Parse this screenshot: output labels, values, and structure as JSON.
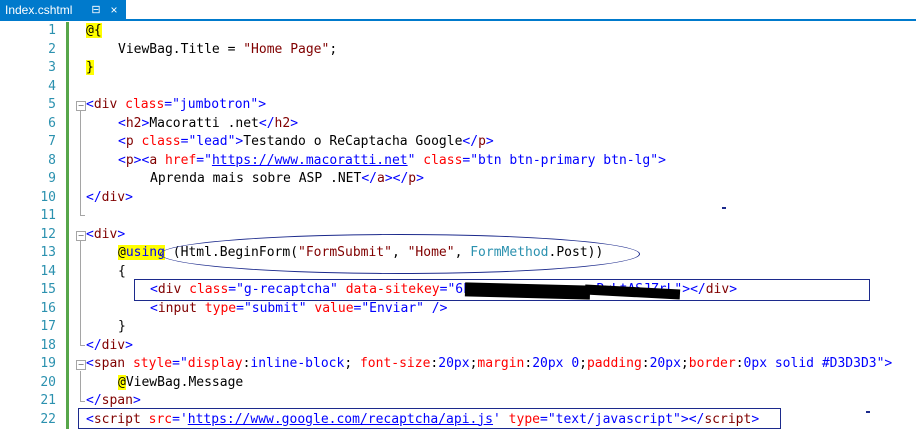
{
  "tab": {
    "title": "Index.cshtml",
    "pin_glyph": "⊟",
    "close_glyph": "×"
  },
  "lines": [
    {
      "n": "1"
    },
    {
      "n": "2"
    },
    {
      "n": "3"
    },
    {
      "n": "4"
    },
    {
      "n": "5"
    },
    {
      "n": "6"
    },
    {
      "n": "7"
    },
    {
      "n": "8"
    },
    {
      "n": "9"
    },
    {
      "n": "10"
    },
    {
      "n": "11"
    },
    {
      "n": "12"
    },
    {
      "n": "13"
    },
    {
      "n": "14"
    },
    {
      "n": "15"
    },
    {
      "n": "16"
    },
    {
      "n": "17"
    },
    {
      "n": "18"
    },
    {
      "n": "19"
    },
    {
      "n": "20"
    },
    {
      "n": "21"
    },
    {
      "n": "22"
    }
  ],
  "code": {
    "l1": {
      "at": "@{"
    },
    "l2": {
      "a": "ViewBag.Title = ",
      "b": "\"Home Page\"",
      "c": ";"
    },
    "l3": {
      "a": "}"
    },
    "l5": {
      "a": "<",
      "b": "div",
      "c": " ",
      "d": "class",
      "e": "=",
      "f": "\"jumbotron\"",
      "g": ">"
    },
    "l6": {
      "a": "<",
      "b": "h2",
      "c": ">",
      "d": "Macoratti .net",
      "e": "</",
      "f": "h2",
      "g": ">"
    },
    "l7": {
      "a": "<",
      "b": "p",
      "c": " ",
      "d": "class",
      "e": "=",
      "f": "\"lead\"",
      "g": ">",
      "h": "Testando o ReCaptacha Google",
      "i": "</",
      "j": "p",
      "k": ">"
    },
    "l8": {
      "a": "<",
      "b": "p",
      "c": "><",
      "d": "a",
      "e": " ",
      "f": "href",
      "g": "=",
      "h": "\"",
      "i": "https://www.macoratti.net",
      "j": "\"",
      "k": " ",
      "l": "class",
      "m": "=",
      "n": "\"btn btn-primary btn-lg\"",
      "o": ">"
    },
    "l9": {
      "a": "Aprenda mais sobre ASP .NET",
      "b": "</",
      "c": "a",
      "d": "></",
      "e": "p",
      "f": ">"
    },
    "l10": {
      "a": "</",
      "b": "div",
      "c": ">"
    },
    "l12": {
      "a": "<",
      "b": "div",
      "c": ">"
    },
    "l13": {
      "at": "@",
      "using": "using",
      "a": " (Html.BeginForm(",
      "b": "\"FormSubmit\"",
      "c": ", ",
      "d": "\"Home\"",
      "e": ", ",
      "f": "FormMethod",
      "g": ".Post))"
    },
    "l14": {
      "a": "{"
    },
    "l15": {
      "a": "<",
      "b": "div",
      "c": " ",
      "d": "class",
      "e": "=",
      "f": "\"g-recaptcha\"",
      "g": " ",
      "h": "data-sitekey",
      "i": "=",
      "j": "\"6Le...............PvLtASJZrL\"",
      "k": "></",
      "l": "div",
      "m": ">"
    },
    "l16": {
      "a": "<",
      "b": "input",
      "c": " ",
      "d": "type",
      "e": "=",
      "f": "\"submit\"",
      "g": " ",
      "h": "value",
      "i": "=",
      "j": "\"Enviar\"",
      "k": " />"
    },
    "l17": {
      "a": "}"
    },
    "l18": {
      "a": "</",
      "b": "div",
      "c": ">"
    },
    "l19": {
      "a": "<",
      "b": "span",
      "c": " ",
      "d": "style",
      "e": "=",
      "f": "\"",
      "g": "display",
      "h": ":",
      "i": "inline-block",
      "j": "; ",
      "k": "font-size",
      "l": ":",
      "m": "20px",
      "n": ";",
      "o": "margin",
      "p": ":",
      "q": "20px 0",
      "r": ";",
      "s": "padding",
      "t": ":",
      "u": "20px",
      "v": ";",
      "w": "border",
      "x": ":",
      "y": "0px solid #D3D3D3",
      "z": "\">"
    },
    "l20": {
      "at": "@",
      "a": "ViewBag.Message"
    },
    "l21": {
      "a": "</",
      "b": "span",
      "c": ">"
    },
    "l22": {
      "a": "<",
      "b": "script",
      "c": " ",
      "d": "src",
      "e": "=",
      "f": "'",
      "g": "https://www.google.com/recaptcha/api.js",
      "h": "'",
      "i": " ",
      "j": "type",
      "k": "=",
      "l": "\"text/javascript\"",
      "m": "></",
      "n": "script",
      "o": ">"
    }
  },
  "colors": {
    "tag": "#800000",
    "attr": "#ff0000",
    "string": "#0000ff",
    "keyword": "#0000ff",
    "type": "#2b91af",
    "razor_highlight": "#ffff00",
    "annotation": "#1c2a8c",
    "line_number": "#2b91af",
    "change_bar": "#57a64a",
    "tab_accent": "#007acc"
  }
}
